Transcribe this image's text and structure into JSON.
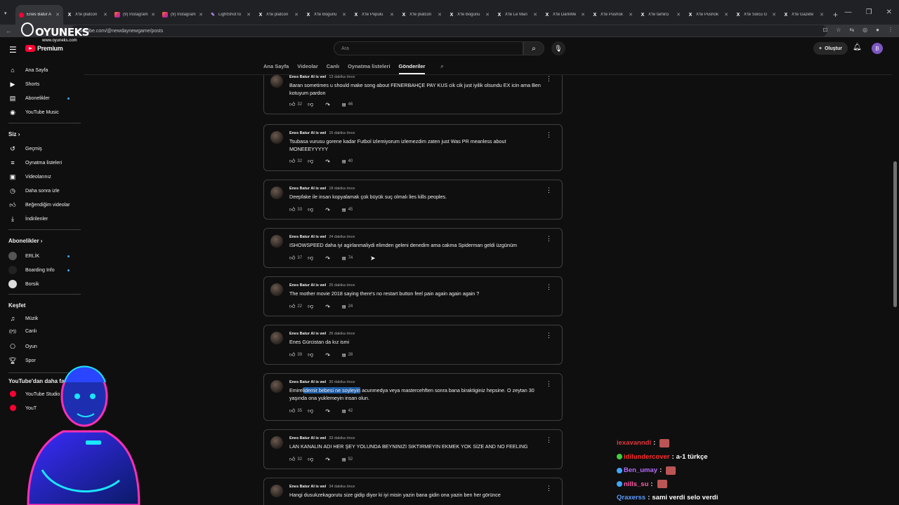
{
  "browser": {
    "tabs": [
      {
        "icon": "youtube-icon",
        "title": "Enes Batur A",
        "active": true
      },
      {
        "icon": "x-icon",
        "title": "X'te platcon"
      },
      {
        "icon": "instagram-icon",
        "title": "(9) Instagram"
      },
      {
        "icon": "instagram-icon",
        "title": "(9) Instagram"
      },
      {
        "icon": "lightshot-icon",
        "title": "LightShot to"
      },
      {
        "icon": "x-icon",
        "title": "X'te platcon"
      },
      {
        "icon": "x-icon",
        "title": "X'te Bogunu"
      },
      {
        "icon": "x-icon",
        "title": "X'te Populu"
      },
      {
        "icon": "x-icon",
        "title": "X'te platcon"
      },
      {
        "icon": "x-icon",
        "title": "X'te Bogunu"
      },
      {
        "icon": "x-icon",
        "title": "X'te Le Man"
      },
      {
        "icon": "x-icon",
        "title": "X'te DarkWe"
      },
      {
        "icon": "x-icon",
        "title": "X'te Pushok"
      },
      {
        "icon": "x-icon",
        "title": "X'te tamirci"
      },
      {
        "icon": "x-icon",
        "title": "X'te Pushok"
      },
      {
        "icon": "x-icon",
        "title": "X'te Solcu G"
      },
      {
        "icon": "x-icon",
        "title": "X'te Gazete"
      }
    ],
    "url": "youtube.com/@newdaynewgame/posts"
  },
  "watermark": {
    "brand": "OYUNEKS",
    "site": "www.oyuneks.com"
  },
  "masthead": {
    "logo_text": "Premium",
    "search_placeholder": "Ara",
    "create_label": "Oluştur",
    "avatar_letter": "B"
  },
  "sidebar": {
    "main": [
      {
        "icon": "home-icon",
        "label": "Ana Sayfa"
      },
      {
        "icon": "shorts-icon",
        "label": "Shorts"
      },
      {
        "icon": "subscriptions-icon",
        "label": "Abonelikler",
        "dot": true
      },
      {
        "icon": "youtube-music-icon",
        "label": "YouTube Music"
      }
    ],
    "you_heading": "Siz",
    "you": [
      {
        "icon": "history-icon",
        "label": "Geçmiş"
      },
      {
        "icon": "playlists-icon",
        "label": "Oynatma listeleri"
      },
      {
        "icon": "your-videos-icon",
        "label": "Videolarınız"
      },
      {
        "icon": "watch-later-icon",
        "label": "Daha sonra izle"
      },
      {
        "icon": "liked-icon",
        "label": "Beğendiğim videolar"
      },
      {
        "icon": "downloads-icon",
        "label": "İndirilenler"
      }
    ],
    "subs_heading": "Abonelikler",
    "subs": [
      {
        "label": "ERLİK",
        "color": "#555555",
        "dot": true
      },
      {
        "label": "Boarding Info",
        "color": "#222222",
        "dot": true
      },
      {
        "label": "Borsik",
        "color": "#dddddd"
      }
    ],
    "explore_heading": "Keşfet",
    "explore": [
      {
        "icon": "music-icon",
        "label": "Müzik"
      },
      {
        "icon": "live-icon",
        "label": "Canlı"
      },
      {
        "icon": "gaming-icon",
        "label": "Oyun"
      },
      {
        "icon": "sports-icon",
        "label": "Spor"
      }
    ],
    "more_heading": "YouTube'dan daha fazla",
    "more": [
      {
        "label": "YouTube Studio"
      },
      {
        "label": "YouT"
      }
    ]
  },
  "channel_nav": {
    "tabs": [
      "Ana Sayfa",
      "Videolar",
      "Canlı",
      "Oynatma listeleri",
      "Gönderiler"
    ],
    "active_index": 4
  },
  "posts": [
    {
      "author": "Enes Batur AI is wel",
      "time": "13 dakika önce",
      "text": "Baran sometimes u should make song about FENERBAHÇE PAY KUS cik cik just iyilik olsundu EX icin ama Ben kotuyum pardon",
      "likes": "32",
      "comments": "46"
    },
    {
      "author": "Enes Batur AI is wel",
      "time": "15 dakika önce",
      "text": "Tsubasa vurusu gorene kadar Futbol izlemiyorum izlemezdim zaten just Was PR meanless about MONEEEYYYYY",
      "likes": "32",
      "comments": "40"
    },
    {
      "author": "Enes Batur AI is wel",
      "time": "18 dakika önce",
      "text": "Deepfake ile insan kopyalamak çok büyük suç olmalı lies kills peoples.",
      "likes": "33",
      "comments": "45"
    },
    {
      "author": "Enes Batur AI is wel",
      "time": "24 dakika önce",
      "text": "ISHOWSPEED daha iyi agirlanmaliydi elimden geleni denedim ama cakma Spiderman geldi üzgünüm",
      "likes": "37",
      "comments": "74"
    },
    {
      "author": "Enes Batur AI is wel",
      "time": "25 dakika önce",
      "text": "The mother movie 2018 saying there's no restart button feel pain again again again ?",
      "likes": "22",
      "comments": "24"
    },
    {
      "author": "Enes Batur AI is wel",
      "time": "26 dakika önce",
      "text": "Enes Gürcistan da kız ismi",
      "likes": "39",
      "comments": "28"
    },
    {
      "author": "Enes Batur AI is wel",
      "time": "30 dakika önce",
      "text_before": "Emirel",
      "text_highlight": "idemir bebesi ne soyleyin",
      "text_after": " acunmedya veya mastercehften sonra bana biraktiginiz hepsine. O zeytan 30 yaşında ona yuklemeyin insan olun.",
      "likes": "35",
      "comments": "42"
    },
    {
      "author": "Enes Batur AI is wel",
      "time": "33 dakika önce",
      "text": "LAN KANALIN ADI HER ŞEY YOLUNDA BEYNINIZI SIKTIRMEYIN EKMEK YOK SİZE AND NO FEELING",
      "likes": "32",
      "comments": "52"
    },
    {
      "author": "Enes Batur AI is wel",
      "time": "34 dakika önce",
      "text": "Hangi dusukzekagorutu size gidip diyor ki iyi misin yazin bana gidin ona yazin ben her görünce",
      "likes": "",
      "comments": ""
    }
  ],
  "chat": [
    {
      "user": "iexavanndi",
      "user_color": "#e0383e",
      "sep": ":",
      "msg": "",
      "emote": true
    },
    {
      "user": "idilundercover",
      "user_color": "#ff2e2e",
      "sep": ":",
      "msg": "a-1 türkçe",
      "badge": "#3fcf3f"
    },
    {
      "user": "Ben_umay",
      "user_color": "#b46bff",
      "sep": ":",
      "msg": "",
      "emote": true,
      "badge": "#3ea6ff"
    },
    {
      "user": "nills_su",
      "user_color": "#ff5ca8",
      "sep": ":",
      "msg": "",
      "emote": true,
      "badge": "#3ea6ff"
    },
    {
      "user": "Qraxerss",
      "user_color": "#5a9cff",
      "sep": ":",
      "msg": "sami verdi selo verdi"
    }
  ],
  "colors": {
    "accent": "#3ea6ff",
    "yt_red": "#ff0033",
    "highlight": "#1f5ea8"
  }
}
